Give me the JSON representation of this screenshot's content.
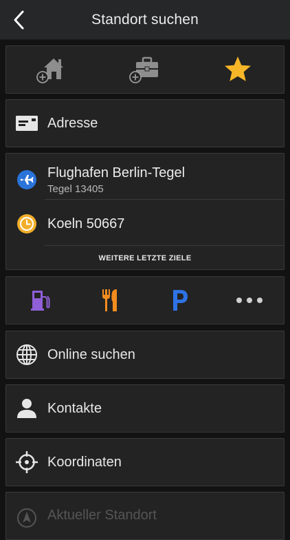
{
  "header": {
    "title": "Standort suchen"
  },
  "quick_actions": {
    "home": "home-add-icon",
    "work": "briefcase-add-icon",
    "favorites": "star-icon",
    "star_color": "#f7b627"
  },
  "address": {
    "label": "Adresse"
  },
  "recent": {
    "items": [
      {
        "title": "Flughafen Berlin-Tegel",
        "subtitle": "Tegel 13405",
        "icon": "airplane-icon"
      },
      {
        "title": "Koeln 50667",
        "icon": "clock-icon"
      }
    ],
    "more_label": "WEITERE LETZTE ZIELE"
  },
  "poi": {
    "items": [
      "fuel-station-icon",
      "restaurant-icon",
      "parking-icon",
      "more-icon"
    ],
    "more_glyph": "•••"
  },
  "menu": {
    "online": "Online suchen",
    "contacts": "Kontakte",
    "coordinates": "Koordinaten",
    "current_location": "Aktueller Standort"
  }
}
